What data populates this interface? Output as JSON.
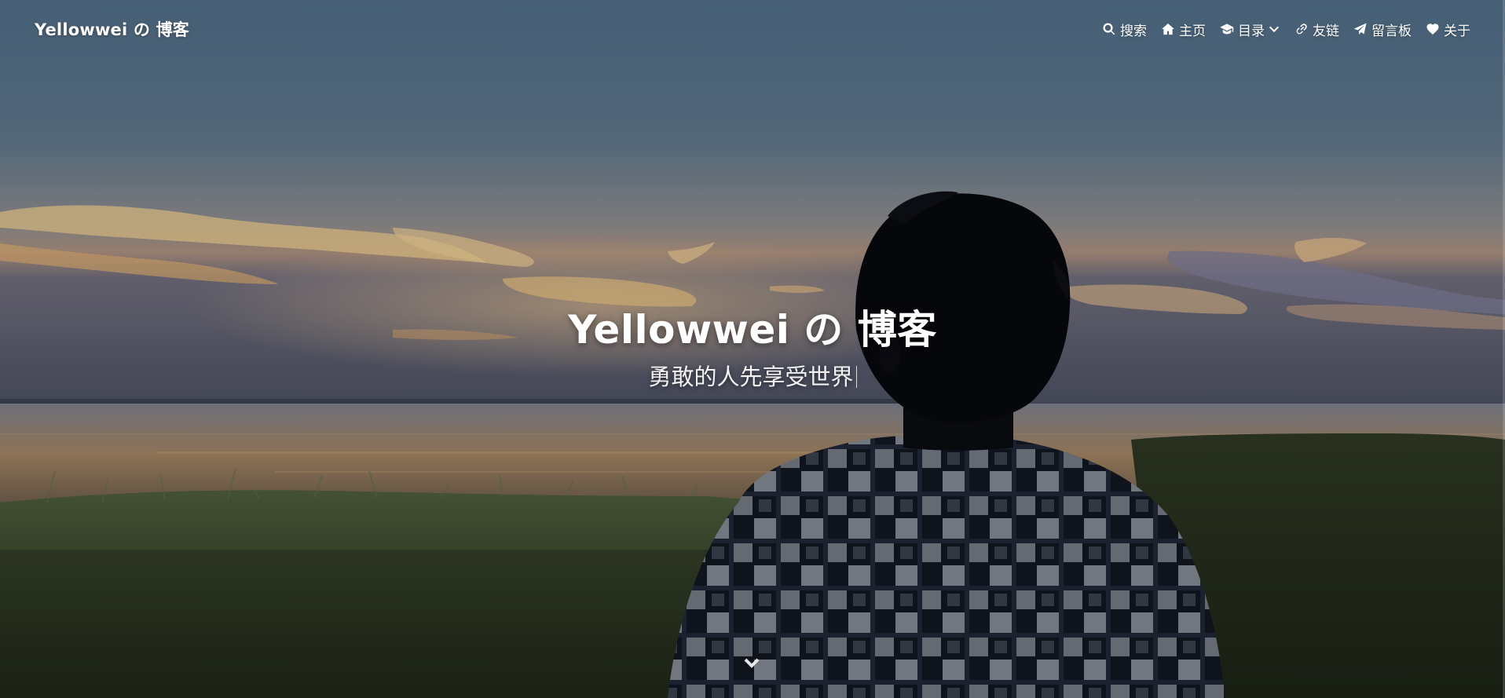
{
  "brand": {
    "title": "Yellowwei の 博客"
  },
  "nav": {
    "items": [
      {
        "label": "搜索",
        "icon": "search-icon"
      },
      {
        "label": "主页",
        "icon": "home-icon"
      },
      {
        "label": "目录",
        "icon": "graduation-cap-icon",
        "has_dropdown": true
      },
      {
        "label": "友链",
        "icon": "link-icon"
      },
      {
        "label": "留言板",
        "icon": "paper-plane-icon"
      },
      {
        "label": "关于",
        "icon": "heart-icon"
      }
    ]
  },
  "hero": {
    "title": "Yellowwei の 博客",
    "subtitle": "勇敢的人先享受世界",
    "scroll_icon": "chevron-down-icon"
  },
  "colors": {
    "text": "#ffffff",
    "sky_top": "#4e6680",
    "sky_horizon": "#c28a55",
    "water": "#8a6e52",
    "grass": "#3a4428",
    "silhouette": "#050507"
  }
}
